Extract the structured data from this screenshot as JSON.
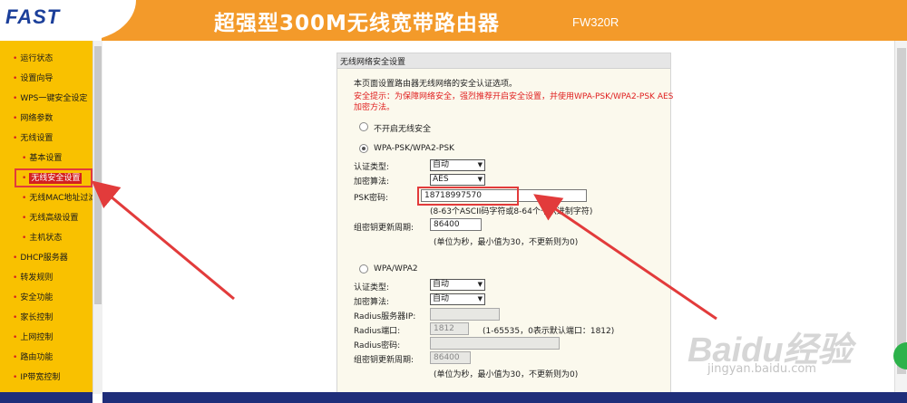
{
  "header": {
    "logo": "FAST",
    "title": "超强型300M无线宽带路由器",
    "model": "FW320R"
  },
  "sidebar": {
    "items": [
      {
        "label": "运行状态"
      },
      {
        "label": "设置向导"
      },
      {
        "label": "WPS一键安全设定"
      },
      {
        "label": "网络参数"
      },
      {
        "label": "无线设置"
      },
      {
        "label": "基本设置"
      },
      {
        "label": "无线安全设置"
      },
      {
        "label": "无线MAC地址过滤"
      },
      {
        "label": "无线高级设置"
      },
      {
        "label": "主机状态"
      },
      {
        "label": "DHCP服务器"
      },
      {
        "label": "转发规则"
      },
      {
        "label": "安全功能"
      },
      {
        "label": "家长控制"
      },
      {
        "label": "上网控制"
      },
      {
        "label": "路由功能"
      },
      {
        "label": "IP带宽控制"
      }
    ]
  },
  "panel": {
    "title": "无线网络安全设置",
    "intro": "本页面设置路由器无线网络的安全认证选项。",
    "warning_line1": "安全提示：为保障网络安全，强烈推荐开启安全设置，并使用WPA-PSK/WPA2-PSK AES",
    "warning_line2": "加密方法。",
    "option_none": "不开启无线安全",
    "option_psk": "WPA-PSK/WPA2-PSK",
    "psk": {
      "auth_label": "认证类型:",
      "auth_value": "自动",
      "enc_label": "加密算法:",
      "enc_value": "AES",
      "key_label": "PSK密码:",
      "key_value": "18718997570",
      "key_hint": "(8-63个ASCII码字符或8-64个十六进制字符)",
      "period_label": "组密钥更新周期:",
      "period_value": "86400",
      "period_hint": "(单位为秒，最小值为30，不更新则为0)"
    },
    "option_wpa": "WPA/WPA2",
    "wpa": {
      "auth_label": "认证类型:",
      "auth_value": "自动",
      "enc_label": "加密算法:",
      "enc_value": "自动",
      "radius_ip_label": "Radius服务器IP:",
      "radius_ip_value": "",
      "radius_port_label": "Radius端口:",
      "radius_port_value": "1812",
      "radius_port_hint": "(1-65535，0表示默认端口：1812)",
      "radius_pwd_label": "Radius密码:",
      "radius_pwd_value": "",
      "period_label": "组密钥更新周期:",
      "period_value": "86400",
      "period_hint": "(单位为秒，最小值为30，不更新则为0)"
    }
  },
  "watermark": {
    "brand": "Baidu经验",
    "url": "jingyan.baidu.com"
  },
  "colors": {
    "header": "#f39a2a",
    "sidebar": "#f9c100",
    "highlight": "#e23b3b"
  }
}
